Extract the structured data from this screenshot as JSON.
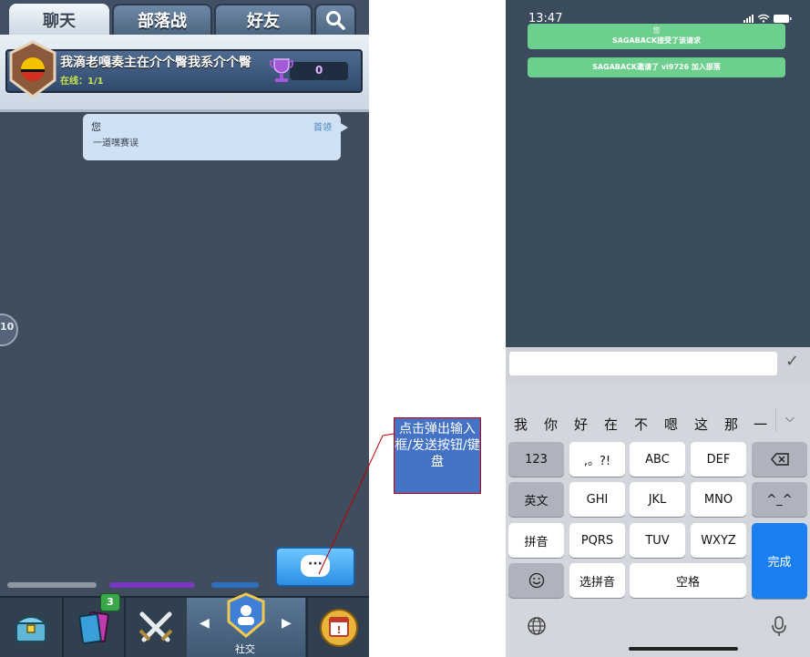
{
  "game": {
    "tabs": [
      "聊天",
      "部落战",
      "好友"
    ],
    "clan": {
      "name": "我滴老嘎奏主在介个臀我系介个臀",
      "online": "在线：1/1",
      "trophies": "0"
    },
    "chat": {
      "sender": "您",
      "role": "首领",
      "message": "一道嘿赛误"
    },
    "side_button_text": "10",
    "nav": {
      "cards_badge": "3",
      "social_label": "社交"
    }
  },
  "callout": {
    "text": "点击弹出输入框/发送按钮/键盘"
  },
  "phone": {
    "status_time": "13:47",
    "notifications": [
      {
        "title": "您",
        "text": "SAGABACK接受了该请求"
      },
      {
        "text": "SAGABACK邀请了 vi9726 加入部落"
      }
    ],
    "candidates": [
      "我",
      "你",
      "好",
      "在",
      "不",
      "嗯",
      "这",
      "那",
      "一"
    ],
    "keys": {
      "row1": [
        "123",
        ",。?!",
        "ABC",
        "DEF"
      ],
      "row2": [
        "英文",
        "GHI",
        "JKL",
        "MNO",
        "^_^"
      ],
      "row3": [
        "拼音",
        "PQRS",
        "TUV",
        "WXYZ"
      ],
      "row4": [
        "选拼音",
        "空格"
      ],
      "done": "完成"
    }
  }
}
